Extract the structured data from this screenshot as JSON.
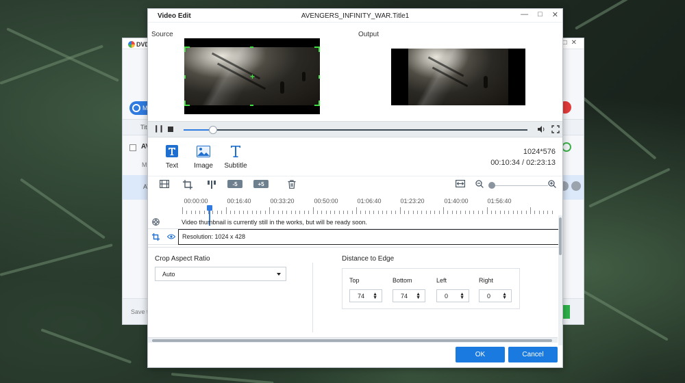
{
  "background_app": {
    "logo_text": "DVD",
    "convert_button_label": "MP",
    "column_header": "Tit",
    "group_title": "AV",
    "group_meta": "MI",
    "row_title": "AV",
    "save_to_label": "Save t"
  },
  "dialog": {
    "title": "Video Edit",
    "file_title": "AVENGERS_INFINITY_WAR.Title1",
    "window_controls": [
      "—",
      "□",
      "✕"
    ]
  },
  "preview": {
    "source_label": "Source",
    "output_label": "Output"
  },
  "player": {
    "progress_fraction": 0.085
  },
  "tools": {
    "text_label": "Text",
    "image_label": "Image",
    "subtitle_label": "Subtitle"
  },
  "video_info": {
    "resolution": "1024*576",
    "time": "00:10:34 / 02:23:13"
  },
  "edit_toolbar": {
    "minus5_label": "-5",
    "plus5_label": "+5"
  },
  "timeline": {
    "labels": [
      "00:00:00",
      "00:16:40",
      "00:33:20",
      "00:50:00",
      "01:06:40",
      "01:23:20",
      "01:40:00",
      "01:56:40"
    ],
    "thumbnail_message": "Video thumbnail is currently still in the works, but will be ready soon.",
    "crop_track_text": "Resolution: 1024 x 428"
  },
  "crop": {
    "aspect_ratio_label": "Crop Aspect Ratio",
    "aspect_ratio_value": "Auto",
    "distance_label": "Distance to Edge",
    "top_label": "Top",
    "bottom_label": "Bottom",
    "left_label": "Left",
    "right_label": "Right",
    "top_value": "74",
    "bottom_value": "74",
    "left_value": "0",
    "right_value": "0"
  },
  "buttons": {
    "ok": "OK",
    "cancel": "Cancel"
  },
  "colors": {
    "accent": "#1a7ae0",
    "crop_guide": "#3fe03f"
  }
}
